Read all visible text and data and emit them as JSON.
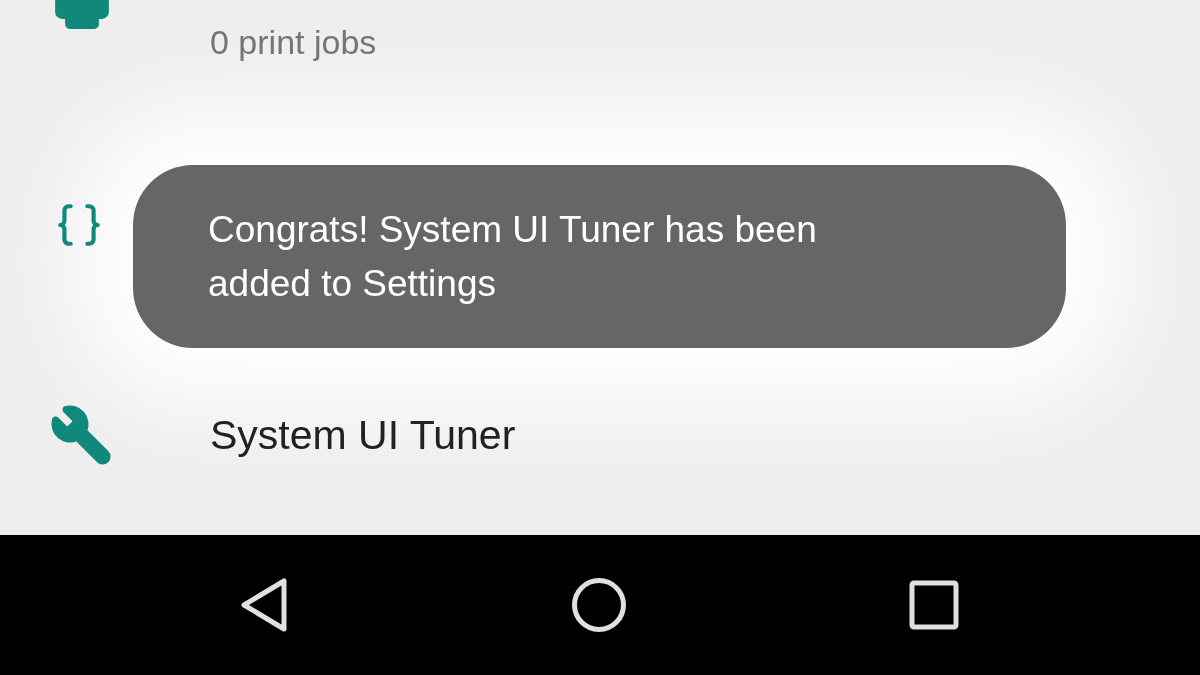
{
  "settings_list": {
    "printing_summary": "0 print jobs",
    "tuner_title": "System UI Tuner"
  },
  "toast": {
    "message": "Congrats! System UI Tuner has been added to Settings"
  }
}
